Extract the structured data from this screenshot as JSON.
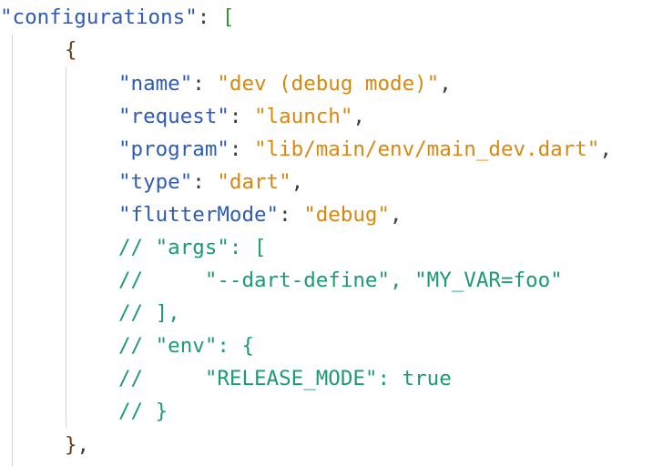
{
  "code": {
    "line1": {
      "key": "\"configurations\"",
      "colon": ": ",
      "bracket": "["
    },
    "line2": {
      "brace": "{"
    },
    "line3": {
      "key": "\"name\"",
      "colon": ": ",
      "value": "\"dev (debug mode)\"",
      "comma": ","
    },
    "line4": {
      "key": "\"request\"",
      "colon": ": ",
      "value": "\"launch\"",
      "comma": ","
    },
    "line5": {
      "key": "\"program\"",
      "colon": ": ",
      "value": "\"lib/main/env/main_dev.dart\"",
      "comma": ","
    },
    "line6": {
      "key": "\"type\"",
      "colon": ": ",
      "value": "\"dart\"",
      "comma": ","
    },
    "line7": {
      "key": "\"flutterMode\"",
      "colon": ": ",
      "value": "\"debug\"",
      "comma": ","
    },
    "line8": {
      "comment": "// \"args\": ["
    },
    "line9": {
      "comment": "//     \"--dart-define\", \"MY_VAR=foo\""
    },
    "line10": {
      "comment": "// ],"
    },
    "line11": {
      "comment": "// \"env\": {"
    },
    "line12": {
      "comment": "//     \"RELEASE_MODE\": true"
    },
    "line13": {
      "comment": "// }"
    },
    "line14": {
      "brace": "}",
      "comma": ","
    }
  },
  "colors": {
    "key": "#2f5ab5",
    "string": "#d9880f",
    "comment": "#1c9c6e",
    "bracket_outer": "#2d9a2d",
    "bracket_inner": "#6f3d1c"
  }
}
